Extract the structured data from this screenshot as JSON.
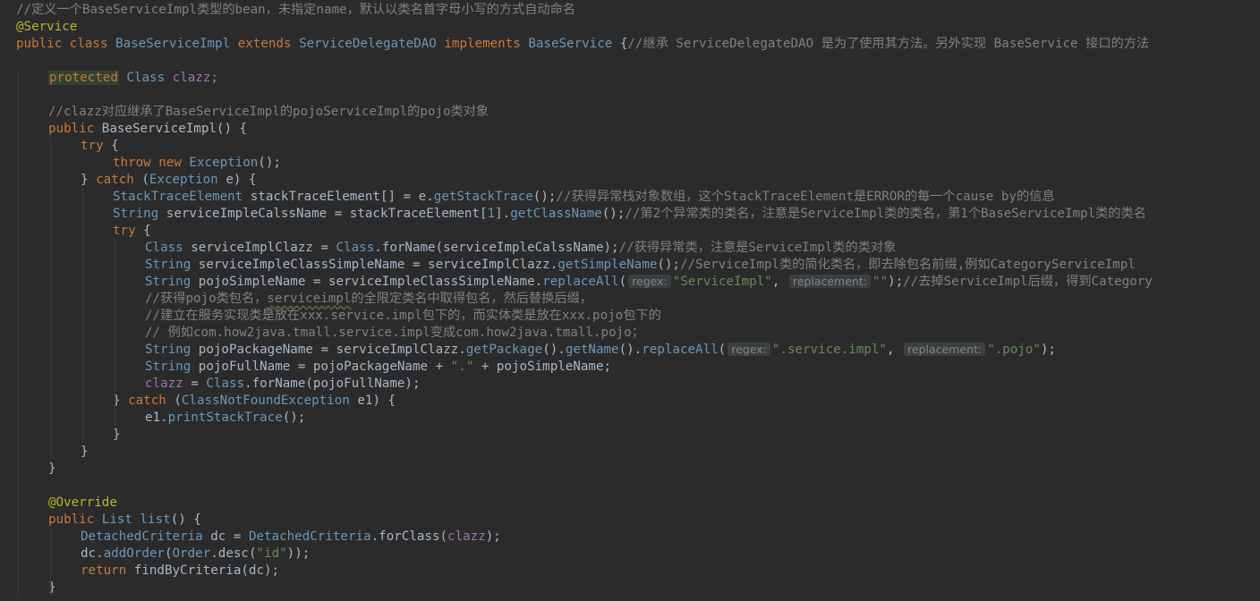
{
  "colors": {
    "background": "#2b2b2b",
    "keyword": "#cc7832",
    "annotation": "#bbb529",
    "type": "#6897bb",
    "comment": "#808080",
    "string": "#6a8759",
    "field": "#9876aa",
    "text": "#a9b7c6"
  },
  "lines": [
    {
      "indent": 0,
      "tokens": [
        {
          "t": "//定义一个BaseServiceImpl类型的bean，未指定name，默认以类名首字母小写的方式自动命名",
          "c": "cmt"
        }
      ]
    },
    {
      "indent": 0,
      "tokens": [
        {
          "t": "@Service",
          "c": "anno"
        }
      ]
    },
    {
      "indent": 0,
      "tokens": [
        {
          "t": "public class ",
          "c": "kw"
        },
        {
          "t": "BaseServiceImpl ",
          "c": "type"
        },
        {
          "t": "extends ",
          "c": "kw"
        },
        {
          "t": "ServiceDelegateDAO ",
          "c": "type"
        },
        {
          "t": "implements ",
          "c": "kw"
        },
        {
          "t": "BaseService ",
          "c": "type"
        },
        {
          "t": "{",
          "c": "id"
        },
        {
          "t": "//继承 ServiceDelegateDAO 是为了使用其方法。另外实现 BaseService 接口的方法",
          "c": "cmt"
        }
      ]
    },
    {
      "indent": 0,
      "tokens": []
    },
    {
      "indent": 1,
      "tokens": [
        {
          "t": "protected",
          "c": "hl-protected"
        },
        {
          "t": " Class ",
          "c": "type"
        },
        {
          "t": "clazz",
          "c": "field"
        },
        {
          "t": ";",
          "c": "kw"
        }
      ]
    },
    {
      "indent": 0,
      "tokens": []
    },
    {
      "indent": 1,
      "tokens": [
        {
          "t": "//clazz对应继承了BaseServiceImpl的pojoServiceImpl的pojo类对象",
          "c": "cmt"
        }
      ]
    },
    {
      "indent": 1,
      "tokens": [
        {
          "t": "public ",
          "c": "kw"
        },
        {
          "t": "BaseServiceImpl() {",
          "c": "id"
        }
      ]
    },
    {
      "indent": 2,
      "tokens": [
        {
          "t": "try ",
          "c": "kw"
        },
        {
          "t": "{",
          "c": "id"
        }
      ]
    },
    {
      "indent": 3,
      "tokens": [
        {
          "t": "throw new ",
          "c": "kw"
        },
        {
          "t": "Exception",
          "c": "type"
        },
        {
          "t": "();",
          "c": "id"
        }
      ]
    },
    {
      "indent": 2,
      "tokens": [
        {
          "t": "} ",
          "c": "id"
        },
        {
          "t": "catch ",
          "c": "kw"
        },
        {
          "t": "(",
          "c": "id"
        },
        {
          "t": "Exception ",
          "c": "type"
        },
        {
          "t": "e) {",
          "c": "id"
        }
      ]
    },
    {
      "indent": 3,
      "tokens": [
        {
          "t": "StackTraceElement ",
          "c": "type"
        },
        {
          "t": "stackTraceElement[] = e.",
          "c": "id"
        },
        {
          "t": "getStackTrace",
          "c": "meth"
        },
        {
          "t": "();",
          "c": "id"
        },
        {
          "t": "//获得异常栈对象数组，这个StackTraceElement是ERROR的每一个cause by的信息",
          "c": "cmt"
        }
      ]
    },
    {
      "indent": 3,
      "tokens": [
        {
          "t": "String ",
          "c": "type"
        },
        {
          "t": "serviceImpleCalssName = stackTraceElement[",
          "c": "id"
        },
        {
          "t": "1",
          "c": "type"
        },
        {
          "t": "].",
          "c": "id"
        },
        {
          "t": "getClassName",
          "c": "meth"
        },
        {
          "t": "();",
          "c": "id"
        },
        {
          "t": "//第2个异常类的类名，注意是ServiceImpl类的类名，第1个BaseServiceImpl类的类名",
          "c": "cmt"
        }
      ]
    },
    {
      "indent": 3,
      "tokens": [
        {
          "t": "try ",
          "c": "kw"
        },
        {
          "t": "{",
          "c": "id"
        }
      ]
    },
    {
      "indent": 4,
      "tokens": [
        {
          "t": "Class ",
          "c": "type"
        },
        {
          "t": "serviceImplClazz = ",
          "c": "id"
        },
        {
          "t": "Class",
          "c": "type"
        },
        {
          "t": ".forName(serviceImpleCalssName);",
          "c": "id"
        },
        {
          "t": "//获得异常类，注意是ServiceImpl类的类对象",
          "c": "cmt"
        }
      ]
    },
    {
      "indent": 4,
      "tokens": [
        {
          "t": "String ",
          "c": "type"
        },
        {
          "t": "serviceImpleClassSimpleName = serviceImplClazz.",
          "c": "id"
        },
        {
          "t": "getSimpleName",
          "c": "meth"
        },
        {
          "t": "();",
          "c": "id"
        },
        {
          "t": "//ServiceImpl类的简化类名，即去除包名前缀,例如CategoryServiceImpl",
          "c": "cmt"
        }
      ]
    },
    {
      "indent": 4,
      "tokens": [
        {
          "t": "String ",
          "c": "type"
        },
        {
          "t": "pojoSimpleName = serviceImpleClassSimpleName.",
          "c": "id"
        },
        {
          "t": "replaceAll",
          "c": "meth"
        },
        {
          "t": "(",
          "c": "id"
        },
        {
          "t": "regex:",
          "c": "hint"
        },
        {
          "t": "\"ServiceImpl\"",
          "c": "str"
        },
        {
          "t": ", ",
          "c": "id"
        },
        {
          "t": "replacement:",
          "c": "hint"
        },
        {
          "t": "\"\"",
          "c": "str"
        },
        {
          "t": ");",
          "c": "id"
        },
        {
          "t": "//去掉ServiceImpl后缀，得到Category",
          "c": "cmt"
        }
      ]
    },
    {
      "indent": 4,
      "tokens": [
        {
          "t": "//获得pojo类包名，",
          "c": "cmt"
        },
        {
          "t": "serviceimpl",
          "c": "cmt wavy"
        },
        {
          "t": "的全限定类名中取得包名，然后替换后缀，",
          "c": "cmt"
        }
      ]
    },
    {
      "indent": 4,
      "tokens": [
        {
          "t": "//建立在服务实现类是放在xxx.service.impl包下的，而实体类是放在xxx.pojo包下的",
          "c": "cmt"
        }
      ]
    },
    {
      "indent": 4,
      "tokens": [
        {
          "t": "// 例如com.how2java.tmall.service.impl变成com.how2java.tmall.pojo；",
          "c": "cmt"
        }
      ]
    },
    {
      "indent": 4,
      "tokens": [
        {
          "t": "String ",
          "c": "type"
        },
        {
          "t": "pojoPackageName = serviceImplClazz.",
          "c": "id"
        },
        {
          "t": "getPackage",
          "c": "meth"
        },
        {
          "t": "().",
          "c": "id"
        },
        {
          "t": "getName",
          "c": "meth"
        },
        {
          "t": "().",
          "c": "id"
        },
        {
          "t": "replaceAll",
          "c": "meth"
        },
        {
          "t": "(",
          "c": "id"
        },
        {
          "t": "regex:",
          "c": "hint"
        },
        {
          "t": "\".service.impl\"",
          "c": "str"
        },
        {
          "t": ", ",
          "c": "id"
        },
        {
          "t": "replacement:",
          "c": "hint"
        },
        {
          "t": "\".pojo\"",
          "c": "str"
        },
        {
          "t": ");",
          "c": "id"
        }
      ]
    },
    {
      "indent": 4,
      "tokens": [
        {
          "t": "String ",
          "c": "type"
        },
        {
          "t": "pojoFullName = pojoPackageName + ",
          "c": "id"
        },
        {
          "t": "\".\"",
          "c": "str"
        },
        {
          "t": " + pojoSimpleName;",
          "c": "id"
        }
      ]
    },
    {
      "indent": 4,
      "tokens": [
        {
          "t": "clazz",
          "c": "field"
        },
        {
          "t": " = ",
          "c": "id"
        },
        {
          "t": "Class",
          "c": "type"
        },
        {
          "t": ".forName(pojoFullName);",
          "c": "id"
        }
      ]
    },
    {
      "indent": 3,
      "tokens": [
        {
          "t": "} ",
          "c": "id"
        },
        {
          "t": "catch ",
          "c": "kw"
        },
        {
          "t": "(",
          "c": "id"
        },
        {
          "t": "ClassNotFoundException ",
          "c": "type"
        },
        {
          "t": "e1) {",
          "c": "id"
        }
      ]
    },
    {
      "indent": 4,
      "tokens": [
        {
          "t": "e1.",
          "c": "id"
        },
        {
          "t": "printStackTrace",
          "c": "meth"
        },
        {
          "t": "();",
          "c": "id"
        }
      ]
    },
    {
      "indent": 3,
      "tokens": [
        {
          "t": "}",
          "c": "id"
        }
      ]
    },
    {
      "indent": 2,
      "tokens": [
        {
          "t": "}",
          "c": "id"
        }
      ]
    },
    {
      "indent": 1,
      "tokens": [
        {
          "t": "}",
          "c": "id"
        }
      ]
    },
    {
      "indent": 0,
      "tokens": []
    },
    {
      "indent": 1,
      "tokens": [
        {
          "t": "@Override",
          "c": "anno"
        }
      ]
    },
    {
      "indent": 1,
      "tokens": [
        {
          "t": "public ",
          "c": "kw"
        },
        {
          "t": "List ",
          "c": "type"
        },
        {
          "t": "list",
          "c": "meth"
        },
        {
          "t": "() {",
          "c": "id"
        }
      ]
    },
    {
      "indent": 2,
      "tokens": [
        {
          "t": "DetachedCriteria ",
          "c": "type"
        },
        {
          "t": "dc = ",
          "c": "id"
        },
        {
          "t": "DetachedCriteria",
          "c": "type"
        },
        {
          "t": ".forClass(",
          "c": "id"
        },
        {
          "t": "clazz",
          "c": "field"
        },
        {
          "t": ");",
          "c": "id"
        }
      ]
    },
    {
      "indent": 2,
      "tokens": [
        {
          "t": "dc.",
          "c": "id"
        },
        {
          "t": "addOrder",
          "c": "meth"
        },
        {
          "t": "(",
          "c": "id"
        },
        {
          "t": "Order",
          "c": "type"
        },
        {
          "t": ".desc(",
          "c": "id"
        },
        {
          "t": "\"id\"",
          "c": "str"
        },
        {
          "t": "));",
          "c": "id"
        }
      ]
    },
    {
      "indent": 2,
      "tokens": [
        {
          "t": "return ",
          "c": "kw"
        },
        {
          "t": "findByCriteria(dc);",
          "c": "id"
        }
      ]
    },
    {
      "indent": 1,
      "tokens": [
        {
          "t": "}",
          "c": "id"
        }
      ]
    }
  ]
}
